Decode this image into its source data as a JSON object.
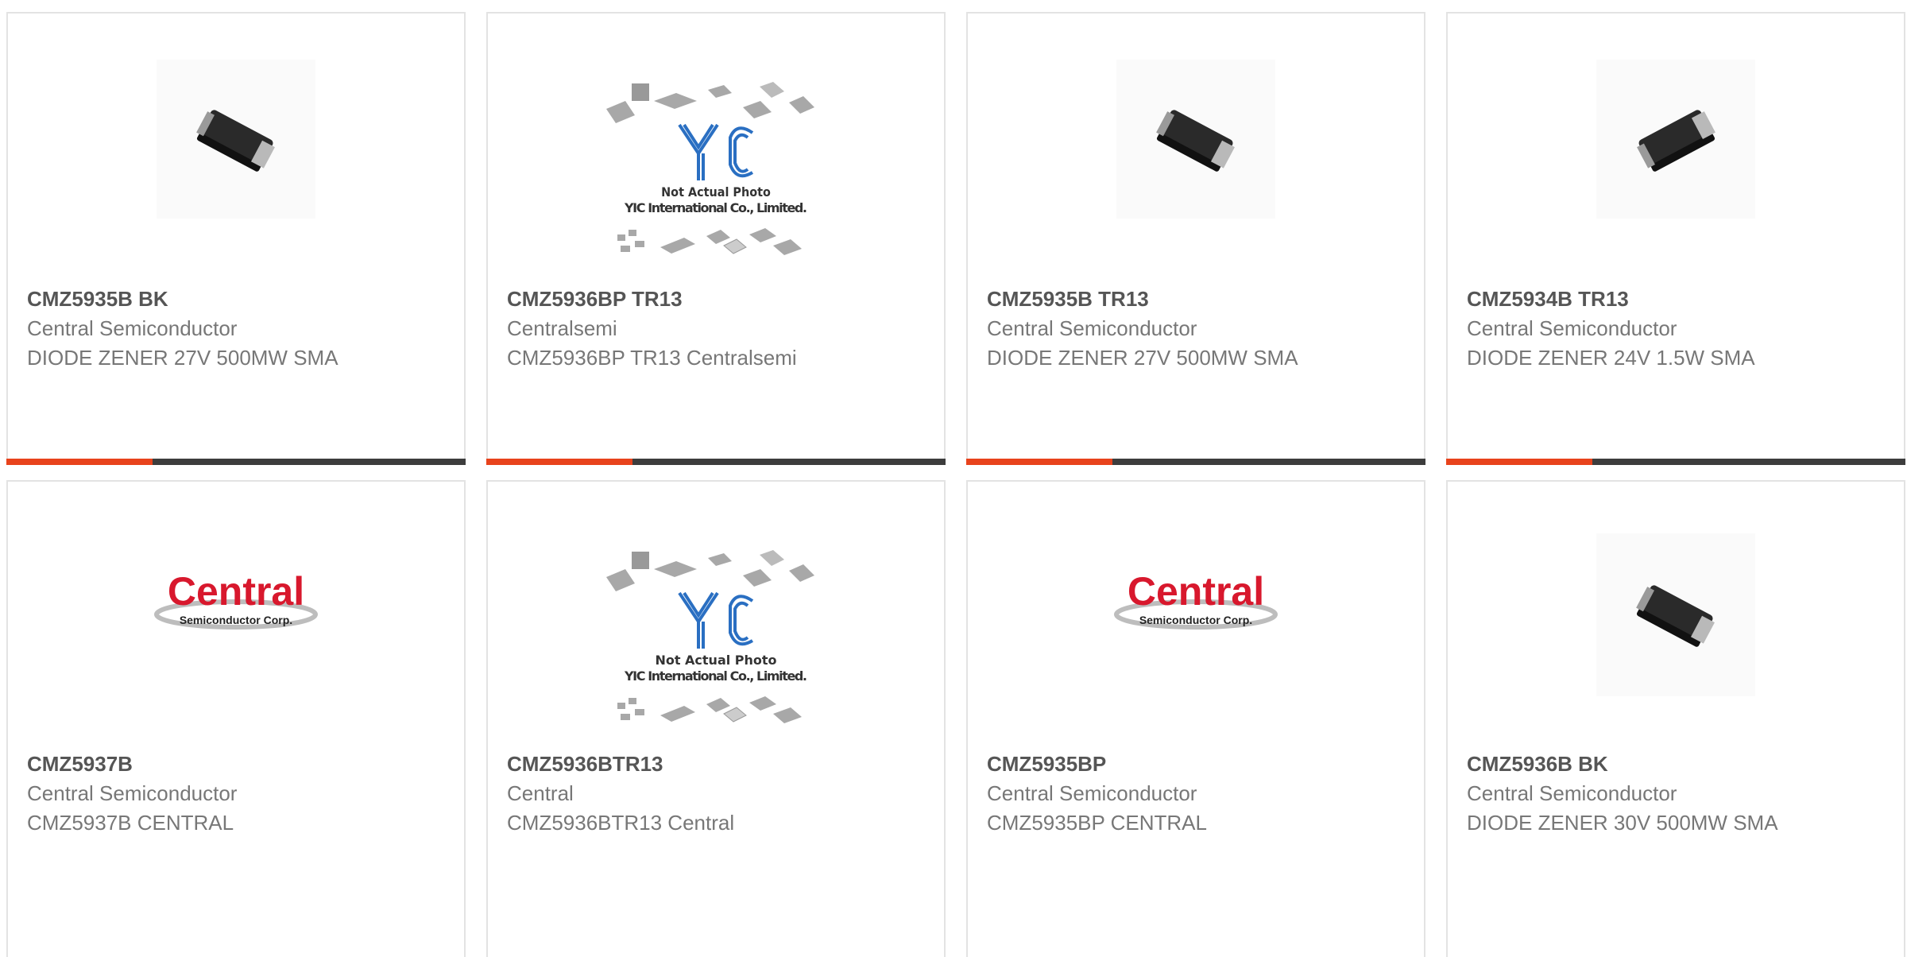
{
  "accent_color": "#e8431c",
  "bar_color": "#3d3d3d",
  "products": [
    {
      "part": "CMZ5935B BK",
      "maker": "Central Semiconductor",
      "desc": "DIODE ZENER 27V 500MW SMA",
      "image": "sma-diode-package"
    },
    {
      "part": "CMZ5936BP TR13",
      "maker": "Centralsemi",
      "desc": "CMZ5936BP TR13 Centralsemi",
      "image": "yic-placeholder",
      "image_text": [
        "YIC",
        "Not Actual Photo",
        "YIC International Co., Limited."
      ]
    },
    {
      "part": "CMZ5935B TR13",
      "maker": "Central Semiconductor",
      "desc": "DIODE ZENER 27V 500MW SMA",
      "image": "sma-diode-package"
    },
    {
      "part": "CMZ5934B TR13",
      "maker": "Central Semiconductor",
      "desc": "DIODE ZENER 24V 1.5W SMA",
      "image": "sma-diode-package"
    },
    {
      "part": "CMZ5937B",
      "maker": "Central Semiconductor",
      "desc": "CMZ5937B CENTRAL",
      "image": "central-semiconductor-logo",
      "image_text": [
        "Central",
        "Semiconductor Corp."
      ]
    },
    {
      "part": "CMZ5936BTR13",
      "maker": "Central",
      "desc": "CMZ5936BTR13 Central",
      "image": "yic-placeholder",
      "image_text": [
        "YIC",
        "Not Actual Photo",
        "YIC International Co., Limited."
      ]
    },
    {
      "part": "CMZ5935BP",
      "maker": "Central Semiconductor",
      "desc": "CMZ5935BP CENTRAL",
      "image": "central-semiconductor-logo",
      "image_text": [
        "Central",
        "Semiconductor Corp."
      ]
    },
    {
      "part": "CMZ5936B BK",
      "maker": "Central Semiconductor",
      "desc": "DIODE ZENER 30V 500MW SMA",
      "image": "sma-diode-package"
    }
  ]
}
